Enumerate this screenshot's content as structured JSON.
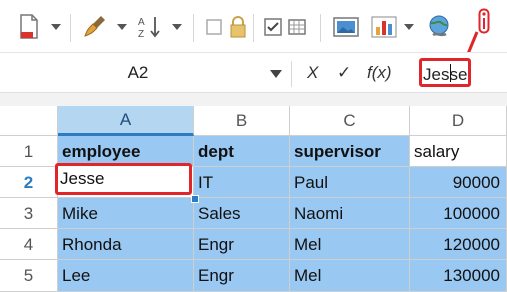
{
  "namebox": {
    "value": "A2"
  },
  "formula": {
    "cancel": "X",
    "accept": "✓",
    "fx": "f(x)",
    "content": "Jesse"
  },
  "columns": [
    "A",
    "B",
    "C",
    "D"
  ],
  "rows": [
    {
      "num": "1",
      "cells": [
        "employee",
        "dept",
        "supervisor",
        "salary"
      ]
    },
    {
      "num": "2",
      "cells": [
        "Jesse",
        "IT",
        "Paul",
        "90000"
      ]
    },
    {
      "num": "3",
      "cells": [
        "Mike",
        "Sales",
        "Naomi",
        "100000"
      ]
    },
    {
      "num": "4",
      "cells": [
        "Rhonda",
        "Engr",
        "Mel",
        "120000"
      ]
    },
    {
      "num": "5",
      "cells": [
        "Lee",
        "Engr",
        "Mel",
        "130000"
      ]
    }
  ],
  "colors": {
    "selection": "#99c8f2",
    "annotation": "#e0262a",
    "accent": "#2b7cc2"
  },
  "icons": [
    "new-document-icon",
    "clear-format-brush-icon",
    "sort-icon",
    "checkbox-icon",
    "lock-icon",
    "checkbox-checked-icon",
    "image-icon",
    "bar-chart-icon",
    "globe-link-icon",
    "info-annotation-icon"
  ]
}
